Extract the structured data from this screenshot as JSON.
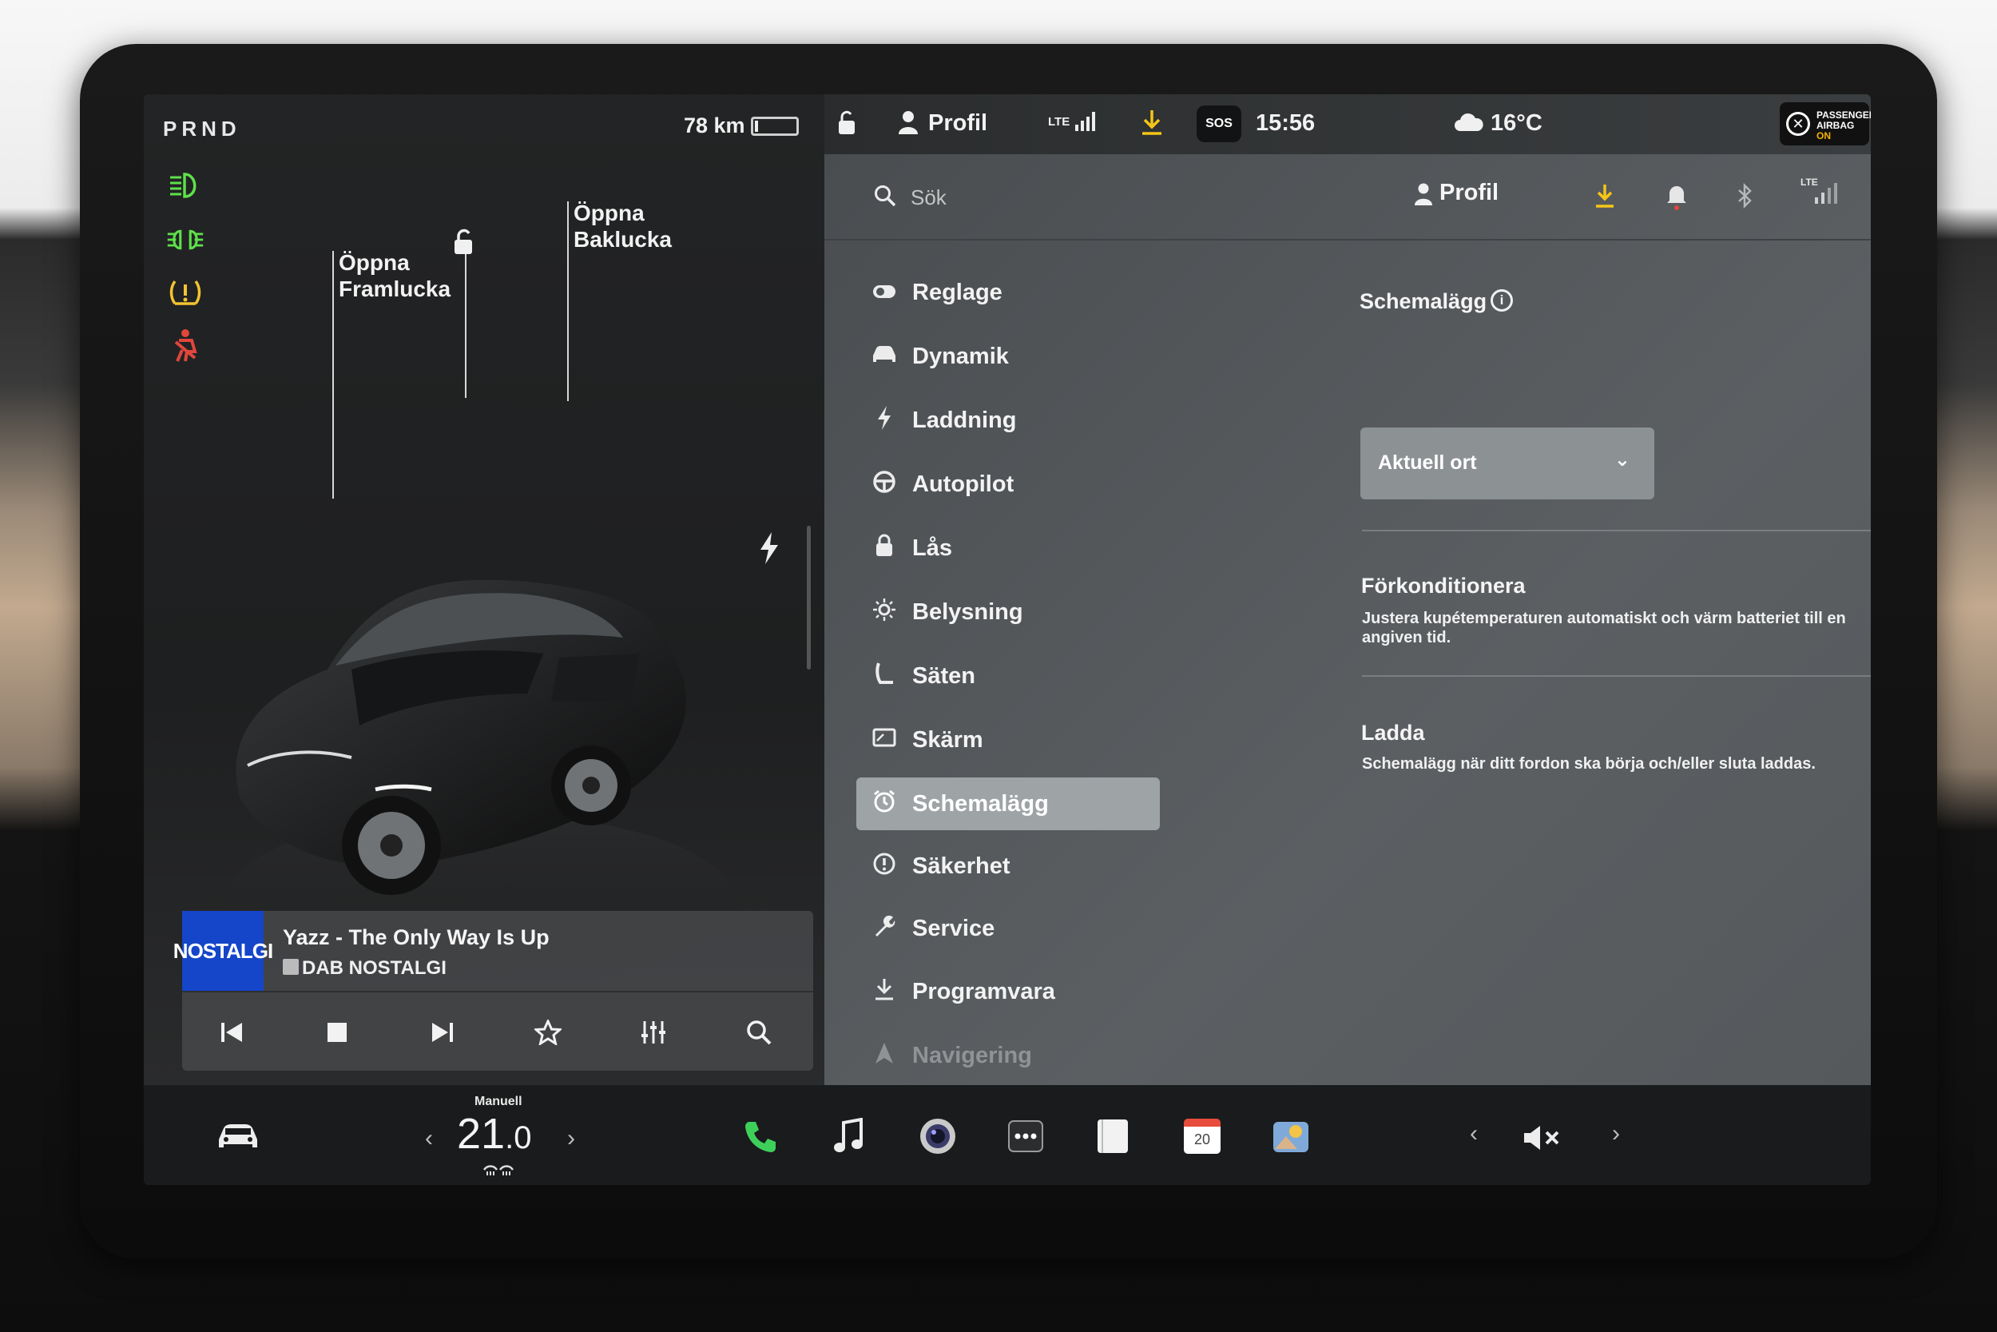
{
  "gear": "PRND",
  "range": "78 km",
  "battery_level": 0.08,
  "colors": {
    "accent_green": "#5ee04a",
    "warning_yellow": "#f4c430",
    "alert_red": "#e0463c",
    "download_yellow": "#f5c518",
    "radio_blue": "#1546c9"
  },
  "telltales": [
    "low-beam-icon",
    "fog-light-icon",
    "tire-pressure-icon",
    "seatbelt-warning-icon"
  ],
  "car_labels": {
    "front_trunk_line1": "Öppna",
    "front_trunk_line2": "Framlucka",
    "rear_trunk_line1": "Öppna",
    "rear_trunk_line2": "Baklucka"
  },
  "media": {
    "art_text": "NOSTALGI",
    "title": "Yazz - The Only Way Is Up",
    "station": "DAB NOSTALGI",
    "page_dots": "• • •"
  },
  "status": {
    "profile": "Profil",
    "network": "LTE",
    "sos": "SOS",
    "time": "15:56",
    "temperature": "16°C",
    "airbag_line1": "PASSENGER",
    "airbag_line2": "AIRBAG",
    "airbag_state": "ON"
  },
  "topbar": {
    "search_placeholder": "Sök",
    "profile": "Profil",
    "network": "LTE"
  },
  "menu": [
    {
      "label": "Reglage",
      "icon": "toggle-icon"
    },
    {
      "label": "Dynamik",
      "icon": "car-icon"
    },
    {
      "label": "Laddning",
      "icon": "bolt-icon"
    },
    {
      "label": "Autopilot",
      "icon": "steering-wheel-icon"
    },
    {
      "label": "Lås",
      "icon": "lock-icon"
    },
    {
      "label": "Belysning",
      "icon": "sun-icon"
    },
    {
      "label": "Säten",
      "icon": "seat-icon"
    },
    {
      "label": "Skärm",
      "icon": "display-icon"
    },
    {
      "label": "Schemalägg",
      "icon": "alarm-clock-icon",
      "active": true
    },
    {
      "label": "Säkerhet",
      "icon": "alert-circle-icon"
    },
    {
      "label": "Service",
      "icon": "wrench-icon"
    },
    {
      "label": "Programvara",
      "icon": "download-icon"
    },
    {
      "label": "Navigering",
      "icon": "navigation-icon"
    }
  ],
  "schedule": {
    "title": "Schemalägg",
    "location_value": "Aktuell ort",
    "precondition_title": "Förkonditionera",
    "precondition_desc": "Justera kupétemperaturen automatiskt och värm batteriet till en angiven tid.",
    "charge_title": "Ladda",
    "charge_desc": "Schemalägg när ditt fordon ska börja och/eller sluta laddas."
  },
  "dock": {
    "climate_mode": "Manuell",
    "temp_whole": "21",
    "temp_decimal": ".0",
    "calendar_day": "20"
  }
}
